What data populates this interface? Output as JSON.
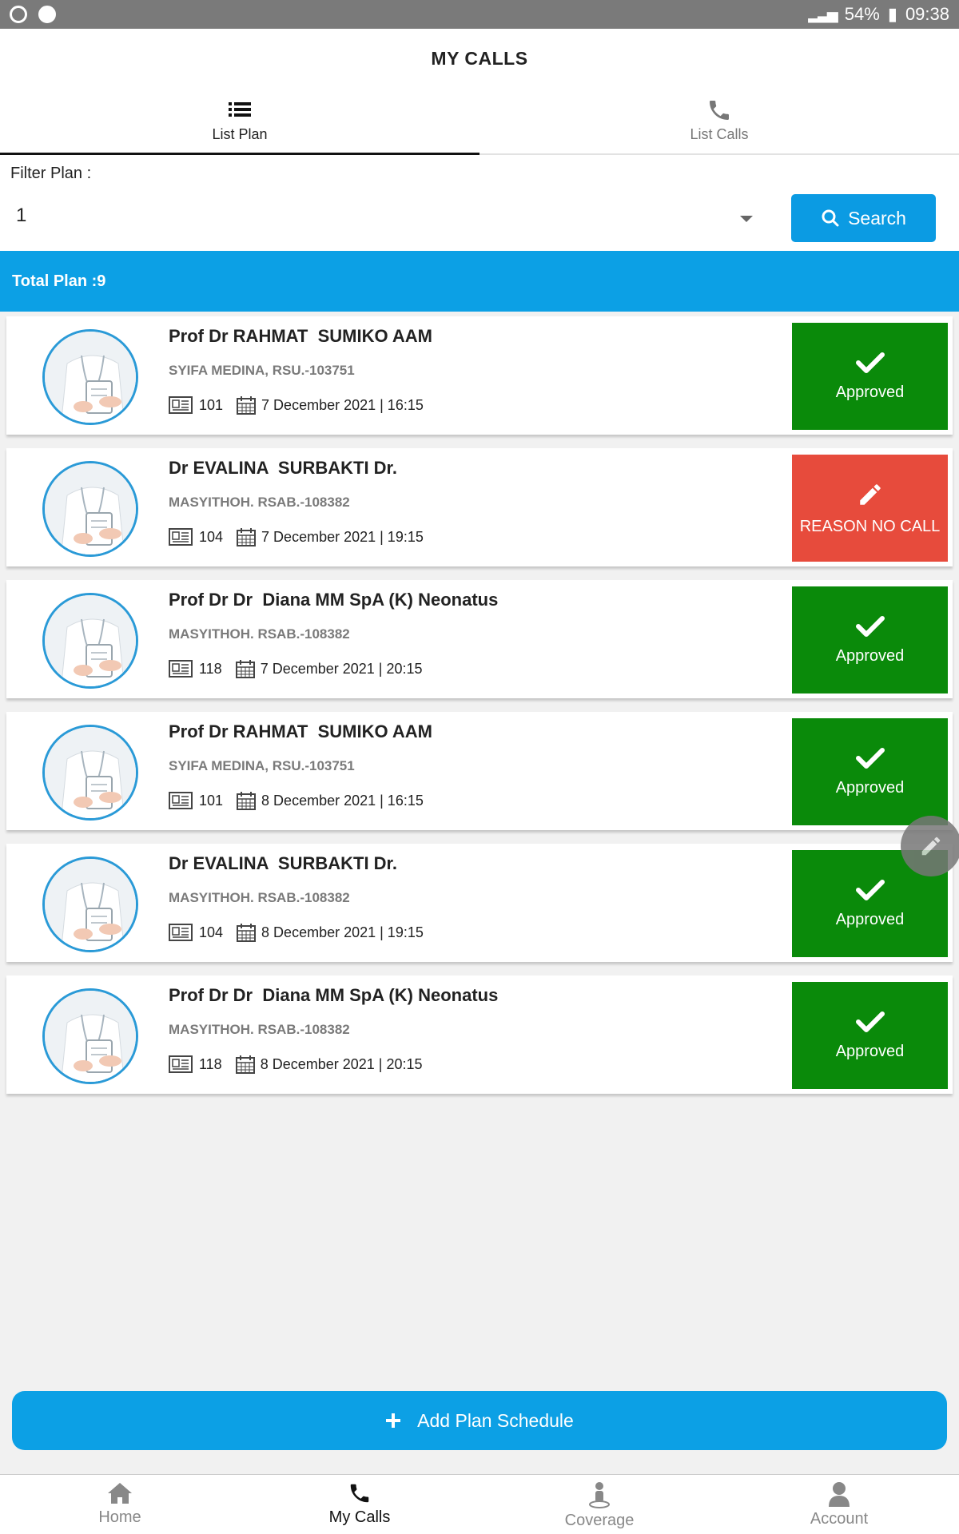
{
  "status_bar": {
    "battery": "54%",
    "time": "09:38"
  },
  "header": {
    "title": "MY CALLS"
  },
  "tabs": [
    {
      "label": "List Plan",
      "icon": "list-icon"
    },
    {
      "label": "List Calls",
      "icon": "phone-icon"
    }
  ],
  "filter": {
    "label": "Filter Plan  :",
    "selected": "1",
    "search_label": "Search"
  },
  "total_plan": "Total Plan :9",
  "plans": [
    {
      "name": "Prof Dr RAHMAT  SUMIKO AAM",
      "org": "SYIFA MEDINA, RSU.-103751",
      "number": "101",
      "datetime": "7 December 2021 | 16:15",
      "status": "Approved"
    },
    {
      "name": "Dr EVALINA  SURBAKTI Dr.",
      "org": "MASYITHOH. RSAB.-108382",
      "number": "104",
      "datetime": "7 December 2021 | 19:15",
      "status": "REASON NO CALL"
    },
    {
      "name": "Prof Dr Dr  Diana MM SpA (K) Neonatus",
      "org": "MASYITHOH. RSAB.-108382",
      "number": "118",
      "datetime": "7 December 2021 | 20:15",
      "status": "Approved"
    },
    {
      "name": "Prof Dr RAHMAT  SUMIKO AAM",
      "org": "SYIFA MEDINA, RSU.-103751",
      "number": "101",
      "datetime": "8 December 2021 | 16:15",
      "status": "Approved"
    },
    {
      "name": "Dr EVALINA  SURBAKTI Dr.",
      "org": "MASYITHOH. RSAB.-108382",
      "number": "104",
      "datetime": "8 December 2021 | 19:15",
      "status": "Approved"
    },
    {
      "name": "Prof Dr Dr  Diana MM SpA (K) Neonatus",
      "org": "MASYITHOH. RSAB.-108382",
      "number": "118",
      "datetime": "8 December 2021 | 20:15",
      "status": "Approved"
    }
  ],
  "add_button": "Add Plan Schedule",
  "nav": [
    {
      "label": "Home",
      "icon": "home-icon"
    },
    {
      "label": "My Calls",
      "icon": "phone-icon"
    },
    {
      "label": "Coverage",
      "icon": "location-person-icon"
    },
    {
      "label": "Account",
      "icon": "user-icon"
    }
  ],
  "colors": {
    "primary": "#0ca0e5",
    "approved": "#0a8a0a",
    "reason": "#e74b3c"
  }
}
